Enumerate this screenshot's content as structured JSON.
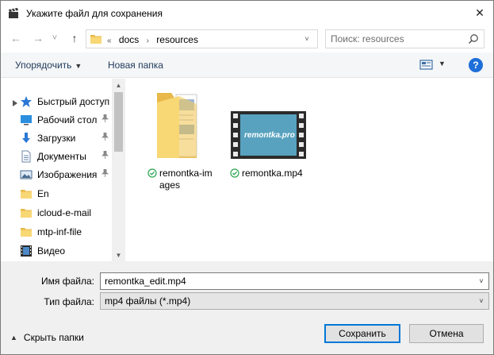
{
  "window": {
    "title": "Укажите файл для сохранения",
    "close_glyph": "✕",
    "app_icon": "clapperboard-icon"
  },
  "nav": {
    "back_glyph": "←",
    "forward_glyph": "→",
    "recent_glyph": "˅",
    "up_glyph": "↑",
    "address": {
      "prefix": "«",
      "crumbs": [
        "docs",
        "resources"
      ],
      "separator": "›",
      "dropdown_glyph": "˅"
    },
    "search": {
      "placeholder": "Поиск: resources"
    }
  },
  "toolbar": {
    "organize": "Упорядочить",
    "organize_caret": "▼",
    "new_folder": "Новая папка",
    "view_caret": "▼",
    "help": "?"
  },
  "sidebar": {
    "quick_access_arrow": "▸",
    "items": [
      {
        "label": "Быстрый доступ",
        "icon": "star-icon",
        "pinned": false
      },
      {
        "label": "Рабочий стол",
        "icon": "desktop-icon",
        "pinned": true
      },
      {
        "label": "Загрузки",
        "icon": "download-icon",
        "pinned": true
      },
      {
        "label": "Документы",
        "icon": "documents-icon",
        "pinned": true
      },
      {
        "label": "Изображения",
        "icon": "pictures-icon",
        "pinned": true
      },
      {
        "label": "En",
        "icon": "folder-icon",
        "pinned": false
      },
      {
        "label": "icloud-e-mail",
        "icon": "folder-icon",
        "pinned": false
      },
      {
        "label": "mtp-inf-file",
        "icon": "folder-icon",
        "pinned": false
      },
      {
        "label": "Видео",
        "icon": "video-icon",
        "pinned": false
      }
    ],
    "pin_glyph": "📌",
    "scroll_up": "▲",
    "scroll_down": "▼"
  },
  "files": [
    {
      "name": "remontka-images",
      "type": "folder",
      "synced": true
    },
    {
      "name": "remontka.mp4",
      "type": "video",
      "synced": true,
      "thumb_text": "remontka.pro"
    }
  ],
  "form": {
    "filename_label": "Имя файла:",
    "filename_value": "remontka_edit.mp4",
    "filetype_label": "Тип файла:",
    "filetype_value": "mp4 файлы (*.mp4)",
    "dropdown_glyph": "˅",
    "hide_folders_glyph": "▲",
    "hide_folders": "Скрыть папки",
    "save_button": "Сохранить",
    "cancel_button": "Отмена"
  },
  "colors": {
    "accent": "#0078d7",
    "folder": "#f5c75a",
    "link": "#1e395b",
    "help": "#1e6fd9",
    "synced": "#2aa44f"
  }
}
